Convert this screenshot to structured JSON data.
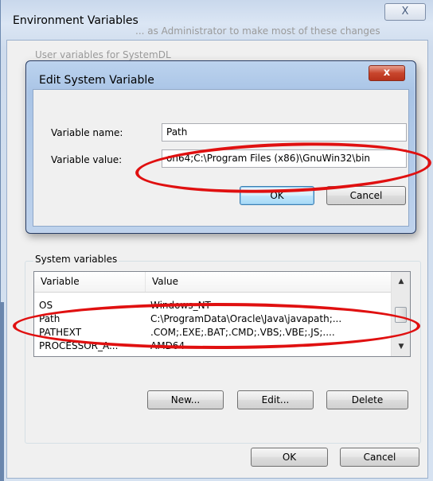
{
  "outer_window": {
    "title": "Environment Variables",
    "close_glyph": "X",
    "ghost_user_label": "User variables for SystemDL",
    "ghost_hint": "... as Administrator to make most of these changes"
  },
  "edit_dialog": {
    "title": "Edit System Variable",
    "close_glyph": "x",
    "name_label": "Variable name:",
    "name_value": "Path",
    "value_label": "Variable value:",
    "value_value": "on64;C:\\Program Files (x86)\\GnuWin32\\bin",
    "ok_label": "OK",
    "cancel_label": "Cancel"
  },
  "system_variables": {
    "group_label": "System variables",
    "columns": [
      "Variable",
      "Value"
    ],
    "rows": [
      {
        "variable": "OS",
        "value": "Windows_NT"
      },
      {
        "variable": "Path",
        "value": "C:\\ProgramData\\Oracle\\Java\\javapath;..."
      },
      {
        "variable": "PATHEXT",
        "value": ".COM;.EXE;.BAT;.CMD;.VBS;.VBE;.JS;...."
      },
      {
        "variable": "PROCESSOR_A...",
        "value": "AMD64"
      }
    ],
    "new_label": "New...",
    "edit_label": "Edit...",
    "delete_label": "Delete"
  },
  "footer": {
    "ok_label": "OK",
    "cancel_label": "Cancel"
  },
  "icons": {
    "scroll_up": "▲",
    "scroll_down": "▼"
  },
  "colors": {
    "highlight_ellipse": "#e01010",
    "close_button_red": "#c8452c"
  }
}
